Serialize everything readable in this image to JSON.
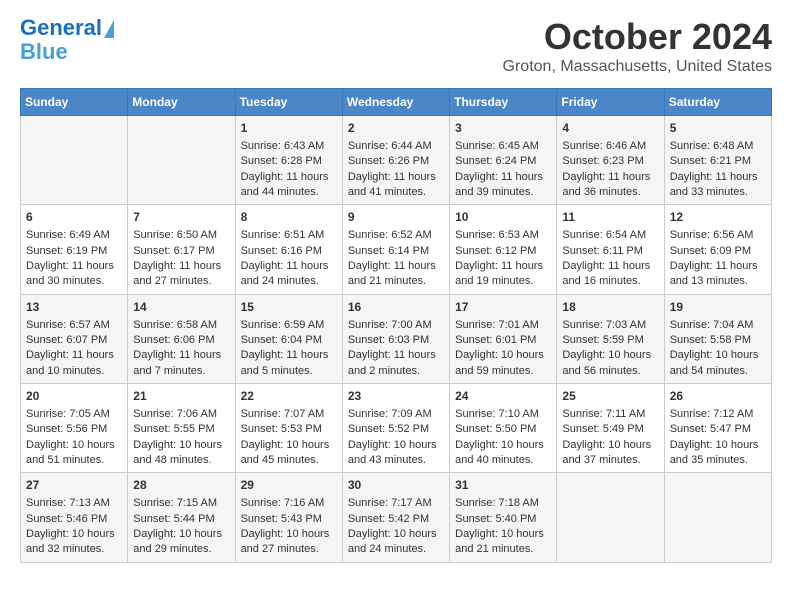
{
  "logo": {
    "line1": "General",
    "line2": "Blue"
  },
  "title": "October 2024",
  "subtitle": "Groton, Massachusetts, United States",
  "days_of_week": [
    "Sunday",
    "Monday",
    "Tuesday",
    "Wednesday",
    "Thursday",
    "Friday",
    "Saturday"
  ],
  "weeks": [
    [
      {
        "day": "",
        "info": ""
      },
      {
        "day": "",
        "info": ""
      },
      {
        "day": "1",
        "info": "Sunrise: 6:43 AM\nSunset: 6:28 PM\nDaylight: 11 hours and 44 minutes."
      },
      {
        "day": "2",
        "info": "Sunrise: 6:44 AM\nSunset: 6:26 PM\nDaylight: 11 hours and 41 minutes."
      },
      {
        "day": "3",
        "info": "Sunrise: 6:45 AM\nSunset: 6:24 PM\nDaylight: 11 hours and 39 minutes."
      },
      {
        "day": "4",
        "info": "Sunrise: 6:46 AM\nSunset: 6:23 PM\nDaylight: 11 hours and 36 minutes."
      },
      {
        "day": "5",
        "info": "Sunrise: 6:48 AM\nSunset: 6:21 PM\nDaylight: 11 hours and 33 minutes."
      }
    ],
    [
      {
        "day": "6",
        "info": "Sunrise: 6:49 AM\nSunset: 6:19 PM\nDaylight: 11 hours and 30 minutes."
      },
      {
        "day": "7",
        "info": "Sunrise: 6:50 AM\nSunset: 6:17 PM\nDaylight: 11 hours and 27 minutes."
      },
      {
        "day": "8",
        "info": "Sunrise: 6:51 AM\nSunset: 6:16 PM\nDaylight: 11 hours and 24 minutes."
      },
      {
        "day": "9",
        "info": "Sunrise: 6:52 AM\nSunset: 6:14 PM\nDaylight: 11 hours and 21 minutes."
      },
      {
        "day": "10",
        "info": "Sunrise: 6:53 AM\nSunset: 6:12 PM\nDaylight: 11 hours and 19 minutes."
      },
      {
        "day": "11",
        "info": "Sunrise: 6:54 AM\nSunset: 6:11 PM\nDaylight: 11 hours and 16 minutes."
      },
      {
        "day": "12",
        "info": "Sunrise: 6:56 AM\nSunset: 6:09 PM\nDaylight: 11 hours and 13 minutes."
      }
    ],
    [
      {
        "day": "13",
        "info": "Sunrise: 6:57 AM\nSunset: 6:07 PM\nDaylight: 11 hours and 10 minutes."
      },
      {
        "day": "14",
        "info": "Sunrise: 6:58 AM\nSunset: 6:06 PM\nDaylight: 11 hours and 7 minutes."
      },
      {
        "day": "15",
        "info": "Sunrise: 6:59 AM\nSunset: 6:04 PM\nDaylight: 11 hours and 5 minutes."
      },
      {
        "day": "16",
        "info": "Sunrise: 7:00 AM\nSunset: 6:03 PM\nDaylight: 11 hours and 2 minutes."
      },
      {
        "day": "17",
        "info": "Sunrise: 7:01 AM\nSunset: 6:01 PM\nDaylight: 10 hours and 59 minutes."
      },
      {
        "day": "18",
        "info": "Sunrise: 7:03 AM\nSunset: 5:59 PM\nDaylight: 10 hours and 56 minutes."
      },
      {
        "day": "19",
        "info": "Sunrise: 7:04 AM\nSunset: 5:58 PM\nDaylight: 10 hours and 54 minutes."
      }
    ],
    [
      {
        "day": "20",
        "info": "Sunrise: 7:05 AM\nSunset: 5:56 PM\nDaylight: 10 hours and 51 minutes."
      },
      {
        "day": "21",
        "info": "Sunrise: 7:06 AM\nSunset: 5:55 PM\nDaylight: 10 hours and 48 minutes."
      },
      {
        "day": "22",
        "info": "Sunrise: 7:07 AM\nSunset: 5:53 PM\nDaylight: 10 hours and 45 minutes."
      },
      {
        "day": "23",
        "info": "Sunrise: 7:09 AM\nSunset: 5:52 PM\nDaylight: 10 hours and 43 minutes."
      },
      {
        "day": "24",
        "info": "Sunrise: 7:10 AM\nSunset: 5:50 PM\nDaylight: 10 hours and 40 minutes."
      },
      {
        "day": "25",
        "info": "Sunrise: 7:11 AM\nSunset: 5:49 PM\nDaylight: 10 hours and 37 minutes."
      },
      {
        "day": "26",
        "info": "Sunrise: 7:12 AM\nSunset: 5:47 PM\nDaylight: 10 hours and 35 minutes."
      }
    ],
    [
      {
        "day": "27",
        "info": "Sunrise: 7:13 AM\nSunset: 5:46 PM\nDaylight: 10 hours and 32 minutes."
      },
      {
        "day": "28",
        "info": "Sunrise: 7:15 AM\nSunset: 5:44 PM\nDaylight: 10 hours and 29 minutes."
      },
      {
        "day": "29",
        "info": "Sunrise: 7:16 AM\nSunset: 5:43 PM\nDaylight: 10 hours and 27 minutes."
      },
      {
        "day": "30",
        "info": "Sunrise: 7:17 AM\nSunset: 5:42 PM\nDaylight: 10 hours and 24 minutes."
      },
      {
        "day": "31",
        "info": "Sunrise: 7:18 AM\nSunset: 5:40 PM\nDaylight: 10 hours and 21 minutes."
      },
      {
        "day": "",
        "info": ""
      },
      {
        "day": "",
        "info": ""
      }
    ]
  ]
}
